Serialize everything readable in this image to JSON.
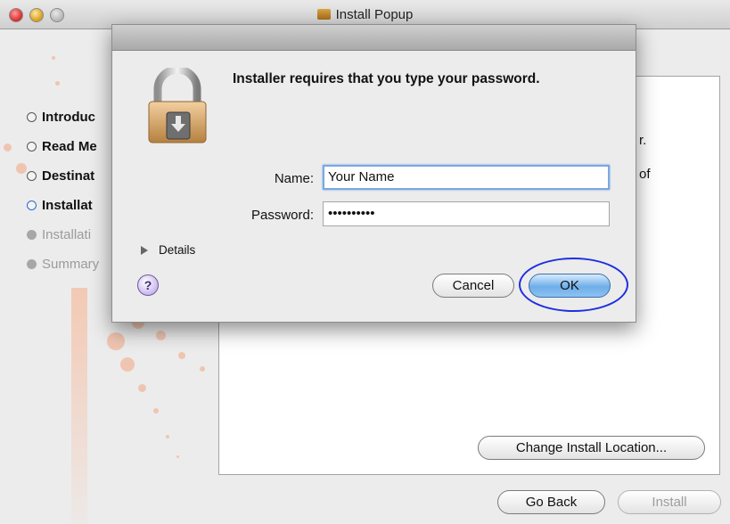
{
  "window": {
    "title": "Install Popup"
  },
  "sidebar": {
    "steps": [
      {
        "label": "Introduc",
        "state": "done"
      },
      {
        "label": "Read Me",
        "state": "done"
      },
      {
        "label": "Destinat",
        "state": "done"
      },
      {
        "label": "Installat",
        "state": "active"
      },
      {
        "label": "Installati",
        "state": "pending"
      },
      {
        "label": "Summary",
        "state": "pending"
      }
    ]
  },
  "content": {
    "peek_text_1": "r.",
    "peek_text_2": "of",
    "change_location_label": "Change Install Location..."
  },
  "footer": {
    "go_back_label": "Go Back",
    "install_label": "Install"
  },
  "dialog": {
    "message": "Installer requires that you type your password.",
    "name_label": "Name:",
    "name_value": "Your Name",
    "password_label": "Password:",
    "password_value": "••••••••••",
    "details_label": "Details",
    "help_label": "?",
    "cancel_label": "Cancel",
    "ok_label": "OK"
  },
  "colors": {
    "accent": "#6faee8",
    "annotation": "#1e2fe0",
    "sidebar_dots": "#f0b89d"
  },
  "icons": [
    "lock-icon",
    "installer-package-icon",
    "help-icon",
    "disclosure-triangle-icon"
  ]
}
